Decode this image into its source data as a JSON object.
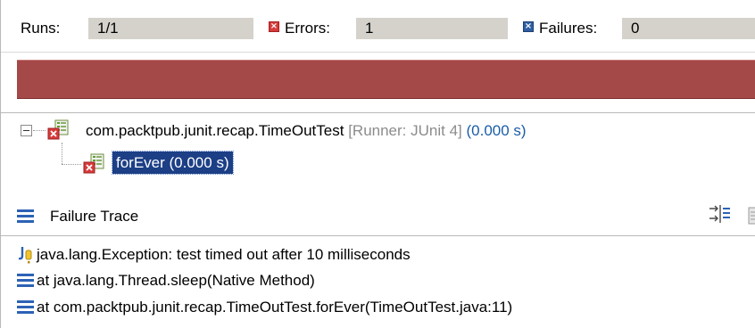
{
  "stats": {
    "runs_label": "Runs:",
    "runs_value": "1/1",
    "errors_label": "Errors:",
    "errors_value": "1",
    "failures_label": "Failures:",
    "failures_value": "0"
  },
  "progress": {
    "state": "failed",
    "fraction": 1.0,
    "color": "#a54848"
  },
  "tree": {
    "suite": {
      "name": "com.packtpub.junit.recap.TimeOutTest",
      "runner": "[Runner: JUnit 4]",
      "time": "(0.000 s)",
      "icon": "test-suite-error-icon"
    },
    "test": {
      "name": "forEver (0.000 s)",
      "icon": "test-error-icon"
    }
  },
  "trace": {
    "title": "Failure Trace",
    "lines": [
      {
        "icon": "junit-exception-icon",
        "text": "java.lang.Exception: test timed out after 10 milliseconds"
      },
      {
        "icon": "stack-frame-icon",
        "text": "at java.lang.Thread.sleep(Native Method)"
      },
      {
        "icon": "stack-frame-icon",
        "text": "at com.packtpub.junit.recap.TimeOutTest.forEver(TimeOutTest.java:11)"
      }
    ]
  }
}
